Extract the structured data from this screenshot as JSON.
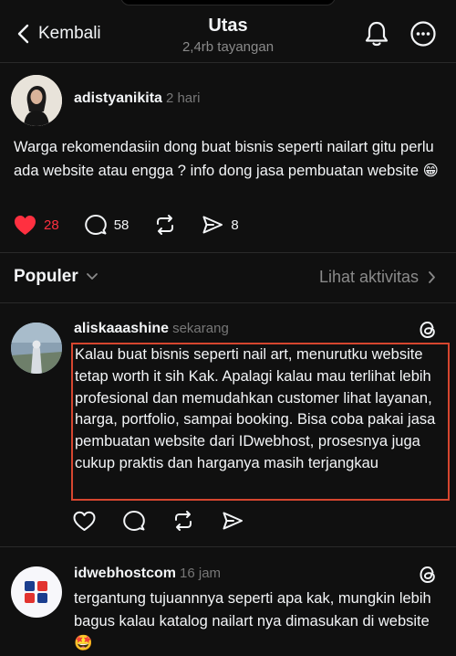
{
  "header": {
    "back_label": "Kembali",
    "title": "Utas",
    "subtitle": "2,4rb tayangan"
  },
  "post": {
    "username": "adistyanikita",
    "time": "2 hari",
    "text": "Warga rekomendasiin dong buat bisnis seperti nailart gitu perlu ada website atau engga ? info dong jasa pembuatan website 😁",
    "likes": "28",
    "replies": "58",
    "shares": "8",
    "liked": true
  },
  "section": {
    "sort_label": "Populer",
    "activity_label": "Lihat aktivitas"
  },
  "replies": [
    {
      "username": "aliskaaashine",
      "time": "sekarang",
      "text": "Kalau buat bisnis seperti nail art, menurutku website tetap worth it sih Kak. Apalagi kalau mau terlihat lebih profesional dan memudahkan customer lihat layanan, harga, portfolio, sampai booking. Bisa coba pakai jasa pembuatan website dari IDwebhost, prosesnya juga cukup praktis dan harganya masih terjangkau"
    },
    {
      "username": "idwebhostcom",
      "time": "16 jam",
      "text": "tergantung tujuannnya seperti apa kak, mungkin lebih bagus kalau katalog nailart nya dimasukan di website 🤩"
    }
  ],
  "colors": {
    "background": "#101010",
    "text": "#f3f5f7",
    "muted": "#8a8a8a",
    "like_red": "#ff3040",
    "highlight_border": "#d6462f"
  }
}
